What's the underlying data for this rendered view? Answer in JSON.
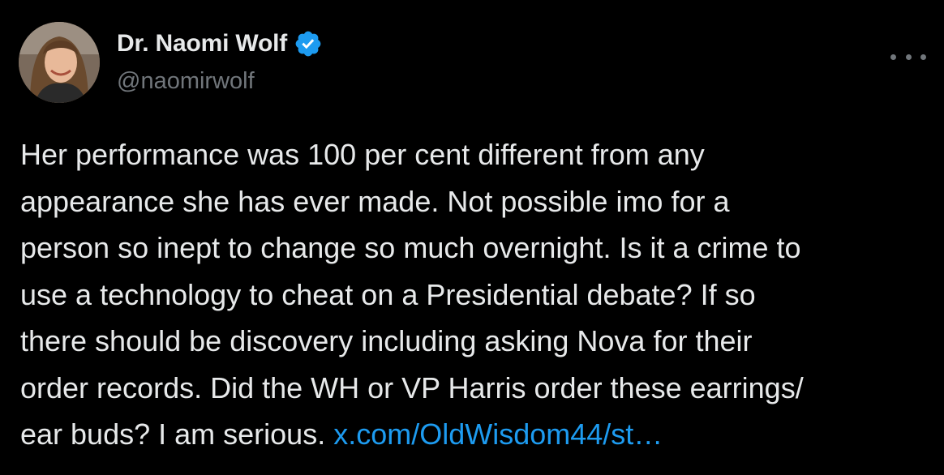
{
  "author": {
    "display_name": "Dr. Naomi Wolf",
    "handle": "@naomirwolf",
    "verified_icon": "verified-badge-icon",
    "verified_color": "#1d9bf0"
  },
  "more_menu_icon": "more-horizontal-icon",
  "tweet": {
    "lines": [
      "Her performance was 100 per cent different from any",
      "appearance she has ever made. Not possible imo for a",
      "person so inept to change so much overnight.  Is it a crime to",
      "use a technology to cheat on a Presidential debate? If so",
      "there should be discovery including asking Nova for their",
      "order records. Did the WH or VP Harris order these earrings/",
      "ear buds? I am serious. "
    ],
    "link_text": "x.com/OldWisdom44/st…"
  },
  "colors": {
    "background": "#000000",
    "text": "#e7e9ea",
    "secondary": "#71767b",
    "link": "#1d9bf0"
  }
}
